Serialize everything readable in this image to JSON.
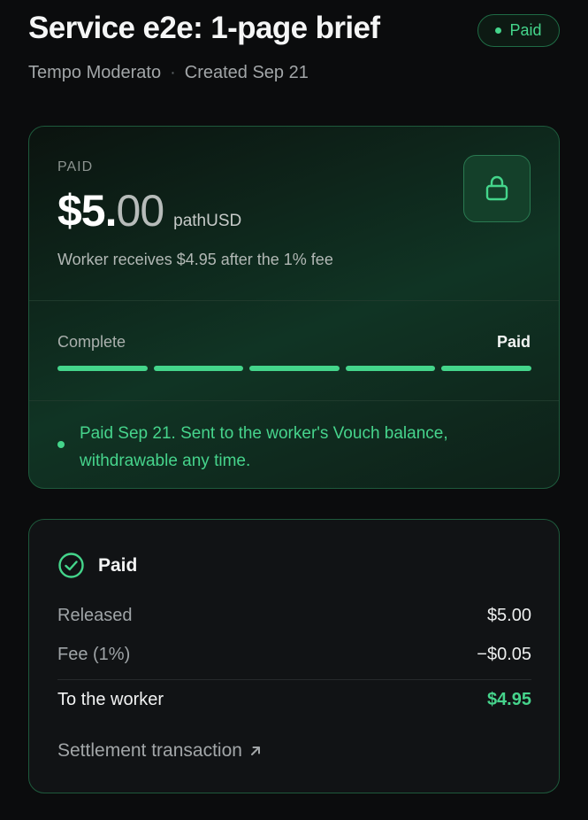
{
  "header": {
    "title": "Service e2e: 1-page brief",
    "status": "Paid",
    "org": "Tempo Moderato",
    "separator": "·",
    "created": "Created Sep 21"
  },
  "payment": {
    "label": "PAID",
    "amount_main": "$5.",
    "amount_cents": "00",
    "currency": "pathUSD",
    "worker_note": "Worker receives $4.95 after the 1% fee",
    "lock_icon": "lock-icon",
    "progress_left": "Complete",
    "progress_right": "Paid",
    "progress_fraction": 1.0,
    "progress_segments": 5,
    "notice": "Paid Sep 21. Sent to the worker's Vouch balance, withdrawable any time."
  },
  "summary": {
    "title": "Paid",
    "rows": [
      {
        "label": "Released",
        "value": "$5.00"
      },
      {
        "label": "Fee (1%)",
        "value": "−$0.05"
      }
    ],
    "total": {
      "label": "To the worker",
      "value": "$4.95"
    },
    "link": "Settlement transaction",
    "link_icon": "arrow-up-right-icon"
  },
  "colors": {
    "accent": "#44d58b",
    "background": "#0b0c0d",
    "border": "#1e5a3c"
  }
}
